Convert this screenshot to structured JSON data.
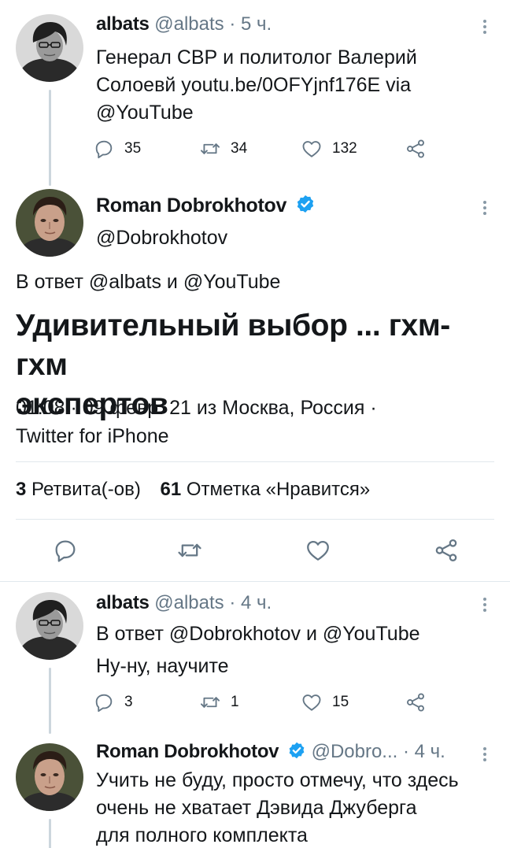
{
  "tweets": [
    {
      "name": "albats",
      "handle": "@albats",
      "time": "5 ч.",
      "text_lines": [
        "Генерал СВР и политолог Валерий",
        "Солоевй youtu.be/0OFYjnf176E via",
        "@YouTube"
      ],
      "replies": "35",
      "retweets": "34",
      "likes": "132"
    },
    {
      "name": "albats",
      "handle": "@albats",
      "time": "4 ч.",
      "reply_to": "В ответ @Dobrokhotov и @YouTube",
      "text": "Ну-ну, научите",
      "replies": "3",
      "retweets": "1",
      "likes": "15"
    },
    {
      "name": "Roman Dobrokhotov",
      "handle": "@Dobro...",
      "time": "4 ч.",
      "text_lines": [
        "Учить не буду, просто отмечу, что здесь",
        "очень не хватает Дэвида Джуберга",
        "для полного комплекта"
      ]
    }
  ],
  "main_tweet": {
    "name": "Roman Dobrokhotov",
    "handle": "@Dobrokhotov",
    "reply_to": "В ответ @albats и @YouTube",
    "text_line1": "Удивительный выбор ... гхм-гхм",
    "text_line2": "экспертов",
    "meta_line1": "01:08 · 09 февр. 21 из Москва, Россия ·",
    "meta_line2": "Twitter for iPhone",
    "retweets_count": "3",
    "retweets_label": "Ретвита(-ов)",
    "likes_count": "61",
    "likes_label": "Отметка «Нравится»"
  },
  "icons": {
    "reply": "reply-bubble-icon",
    "retweet": "retweet-icon",
    "like": "heart-icon",
    "share": "share-icon",
    "verified": "verified-badge-icon",
    "more": "more-vertical-icon"
  },
  "colors": {
    "verified": "#1da1f2",
    "icon_gray": "#657786",
    "thread_line": "#ccd6dd",
    "divider": "#e1e8ed"
  }
}
